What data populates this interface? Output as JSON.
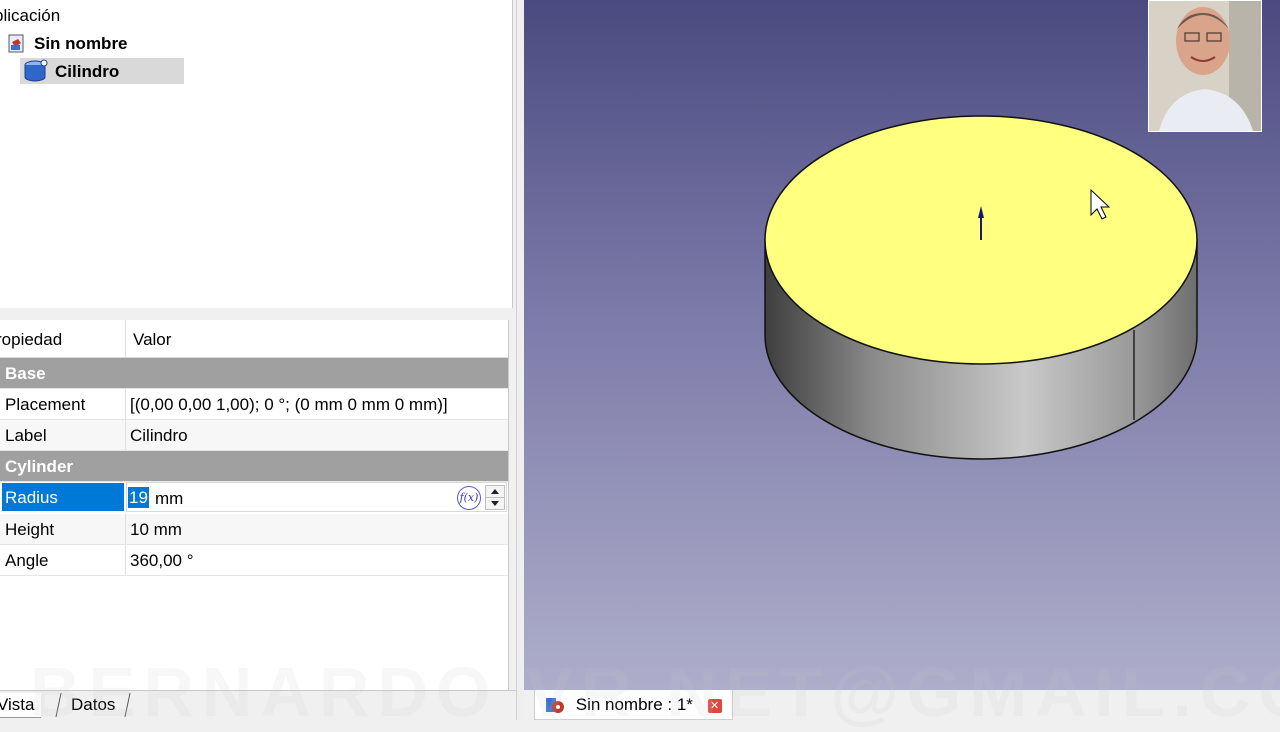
{
  "tree": {
    "root_label": "plicación",
    "document_label": "Sin nombre",
    "object_label": "Cilindro"
  },
  "properties": {
    "header": {
      "property": "ropiedad",
      "value": "Valor"
    },
    "groups": [
      {
        "name": "Base",
        "rows": [
          {
            "key": "Placement",
            "value": "[(0,00 0,00 1,00); 0 °; (0 mm  0 mm  0 mm)]"
          },
          {
            "key": "Label",
            "value": "Cilindro"
          }
        ]
      },
      {
        "name": "Cylinder",
        "rows": [
          {
            "key": "Radius",
            "value": "19",
            "unit": "mm"
          },
          {
            "key": "Height",
            "value": "10 mm"
          },
          {
            "key": "Angle",
            "value": "360,00 °"
          }
        ]
      }
    ],
    "expression_button": "f(x)"
  },
  "bottom_tabs": [
    "Vista",
    "Datos"
  ],
  "viewport": {
    "document_tab": "Sin nombre : 1*",
    "top_face_color": "#ffff80",
    "background_top": "#4a4a80",
    "background_bottom": "#aeaecb"
  },
  "watermark": "BERNARDO VR NET@GMAIL.COM",
  "icons": [
    "document-icon",
    "cylinder-icon",
    "expression-icon",
    "gear-icon",
    "close-icon",
    "mouse-cursor-icon"
  ]
}
